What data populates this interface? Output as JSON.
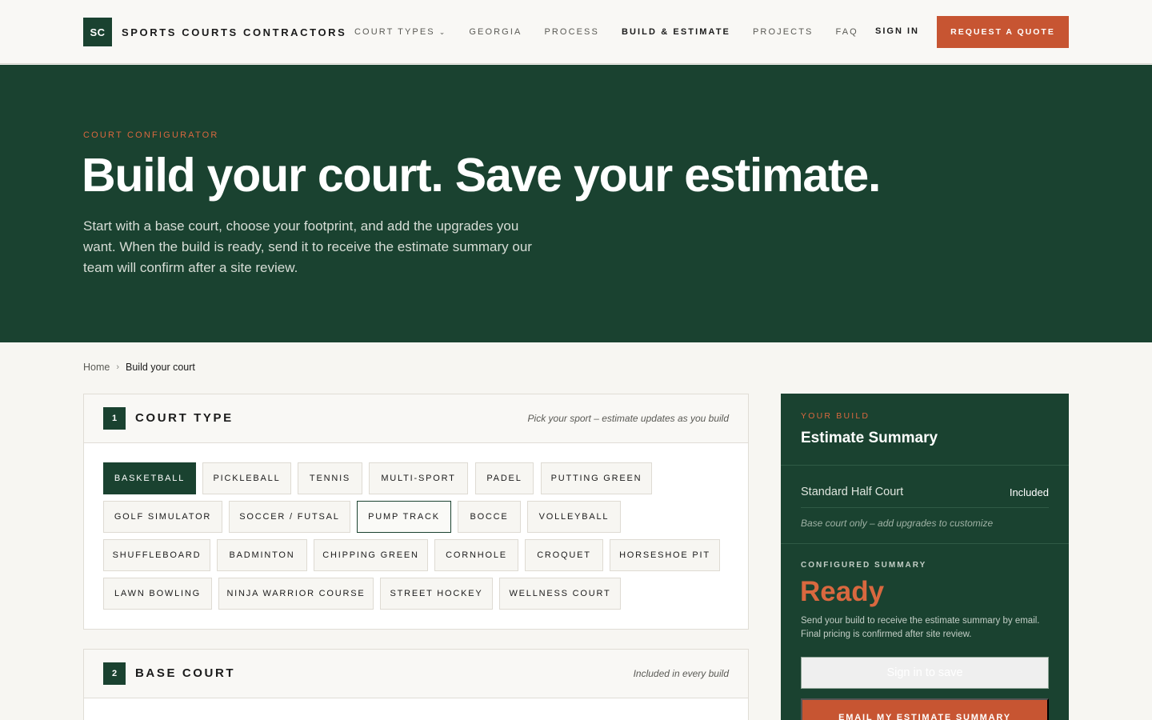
{
  "header": {
    "logo_mark": "SC",
    "brand": "SPORTS COURTS CONTRACTORS",
    "nav": [
      {
        "label": "COURT TYPES",
        "has_dropdown": true
      },
      {
        "label": "GEORGIA"
      },
      {
        "label": "PROCESS"
      },
      {
        "label": "BUILD & ESTIMATE",
        "active": true
      },
      {
        "label": "PROJECTS"
      },
      {
        "label": "FAQ"
      }
    ],
    "sign_in": "SIGN IN",
    "cta": "REQUEST A QUOTE"
  },
  "hero": {
    "eyebrow": "COURT CONFIGURATOR",
    "title": "Build your court. Save your estimate.",
    "subtitle": "Start with a base court, choose your footprint, and add the upgrades you want. When the build is ready, send it to receive the estimate summary our team will confirm after a site review."
  },
  "breadcrumb": {
    "home": "Home",
    "current": "Build your court"
  },
  "steps": [
    {
      "number": "1",
      "title": "COURT TYPE",
      "hint": "Pick your sport – estimate updates as you build",
      "options": [
        "BASKETBALL",
        "PICKLEBALL",
        "TENNIS",
        "MULTI-SPORT",
        "PADEL",
        "PUTTING GREEN",
        "GOLF SIMULATOR",
        "SOCCER / FUTSAL",
        "PUMP TRACK",
        "BOCCE",
        "VOLLEYBALL",
        "SHUFFLEBOARD",
        "BADMINTON",
        "CHIPPING GREEN",
        "CORNHOLE",
        "CROQUET",
        "HORSESHOE PIT",
        "LAWN BOWLING",
        "NINJA WARRIOR COURSE",
        "STREET HOCKEY",
        "WELLNESS COURT"
      ],
      "selected": "BASKETBALL",
      "focused": "PUMP TRACK"
    },
    {
      "number": "2",
      "title": "BASE COURT",
      "hint": "Included in every build"
    }
  ],
  "summary": {
    "eyebrow": "YOUR BUILD",
    "title": "Estimate Summary",
    "line_item": {
      "name": "Standard Half Court",
      "value": "Included"
    },
    "note": "Base court only – add upgrades to customize",
    "configured_label": "CONFIGURED SUMMARY",
    "status": "Ready",
    "description": "Send your build to receive the estimate summary by email. Final pricing is confirmed after site review.",
    "save_button": "Sign in to save",
    "email_button": "EMAIL MY ESTIMATE SUMMARY"
  },
  "colors": {
    "brand_green": "#1a4230",
    "accent_orange": "#c75532",
    "background": "#f7f6f2"
  }
}
